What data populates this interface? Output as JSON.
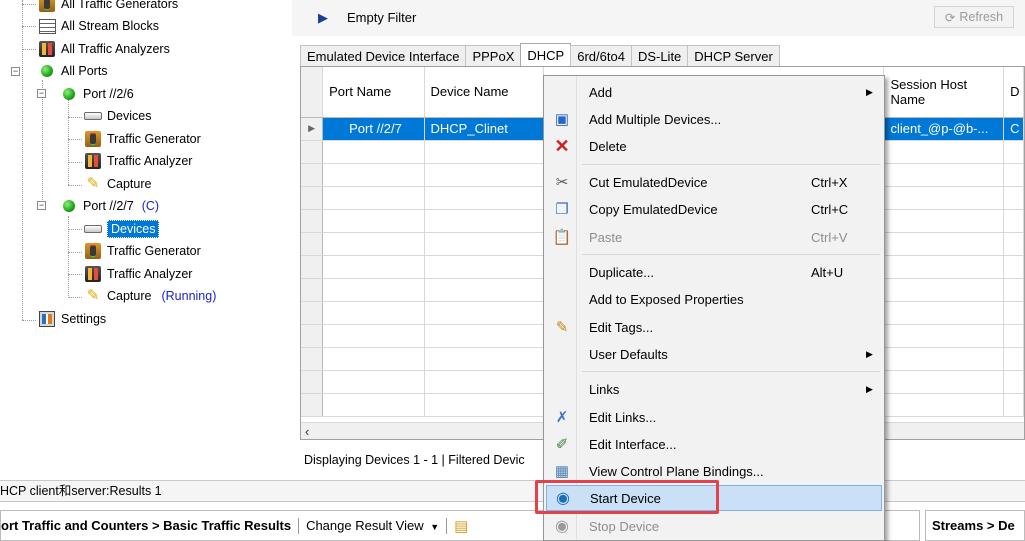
{
  "tree": {
    "items": [
      {
        "label": "All Traffic Generators",
        "icon": "traffic-generator-icon"
      },
      {
        "label": "All Stream Blocks",
        "icon": "stream-blocks-icon"
      },
      {
        "label": "All Traffic Analyzers",
        "icon": "traffic-analyzer-icon"
      },
      {
        "label": "All Ports",
        "icon": "port-status-icon"
      },
      {
        "label": "Port //2/6",
        "icon": "port-status-icon"
      },
      {
        "label": "Devices",
        "icon": "devices-icon"
      },
      {
        "label": "Traffic Generator",
        "icon": "traffic-generator-icon"
      },
      {
        "label": "Traffic Analyzer",
        "icon": "traffic-analyzer-icon"
      },
      {
        "label": "Capture",
        "icon": "capture-icon"
      },
      {
        "label": "Port //2/7",
        "suffix": "(C)",
        "icon": "port-status-icon"
      },
      {
        "label": "Devices",
        "icon": "devices-icon"
      },
      {
        "label": "Traffic Generator",
        "icon": "traffic-generator-icon"
      },
      {
        "label": "Traffic Analyzer",
        "icon": "traffic-analyzer-icon"
      },
      {
        "label": "Capture",
        "suffix": "(Running)",
        "icon": "capture-icon"
      },
      {
        "label": "Settings",
        "icon": "settings-icon"
      }
    ]
  },
  "toolbar": {
    "filter_label": "Empty Filter",
    "refresh_label": "Refresh"
  },
  "tabs": [
    {
      "label": "Emulated Device Interface"
    },
    {
      "label": "PPPoX"
    },
    {
      "label": "DHCP",
      "active": true
    },
    {
      "label": "6rd/6to4"
    },
    {
      "label": "DS-Lite"
    },
    {
      "label": "DHCP Server"
    }
  ],
  "grid": {
    "columns": [
      "Port Name",
      "Device Name",
      "Session Host Name",
      "D"
    ],
    "rows": [
      {
        "port_name": "Port //2/7",
        "device_name": "DHCP_Clinet",
        "session_host": "client_@p-@b-...",
        "d": "C"
      }
    ]
  },
  "status": {
    "text": "Displaying Devices 1 - 1  |  Filtered Devic"
  },
  "results": {
    "title": "HCP client和server:Results 1",
    "breadcrumb": "ort Traffic and Counters > Basic Traffic Results",
    "change_view": "Change Result View",
    "streams_label": "Streams > De"
  },
  "menu": {
    "items": [
      {
        "label": "Add",
        "submenu": true,
        "icon": ""
      },
      {
        "label": "Add Multiple Devices...",
        "icon": "add-multiple-devices-icon"
      },
      {
        "label": "Delete",
        "icon": "delete-icon"
      },
      {
        "label": "Cut EmulatedDevice",
        "shortcut": "Ctrl+X",
        "icon": "cut-icon"
      },
      {
        "label": "Copy EmulatedDevice",
        "shortcut": "Ctrl+C",
        "icon": "copy-icon"
      },
      {
        "label": "Paste",
        "shortcut": "Ctrl+V",
        "icon": "paste-icon",
        "disabled": true
      },
      {
        "label": "Duplicate...",
        "shortcut": "Alt+U",
        "icon": ""
      },
      {
        "label": "Add to Exposed Properties",
        "icon": ""
      },
      {
        "label": "Edit Tags...",
        "icon": "edit-tags-icon"
      },
      {
        "label": "User Defaults",
        "submenu": true,
        "icon": ""
      },
      {
        "label": "Links",
        "submenu": true,
        "icon": ""
      },
      {
        "label": "Edit Links...",
        "icon": "edit-links-icon"
      },
      {
        "label": "Edit Interface...",
        "icon": "edit-interface-icon"
      },
      {
        "label": "View Control Plane Bindings...",
        "icon": "bindings-icon"
      },
      {
        "label": "Start Device",
        "icon": "start-device-icon",
        "highlighted": true
      },
      {
        "label": "Stop Device",
        "icon": "stop-device-icon",
        "disabled": true
      }
    ]
  },
  "colors": {
    "selection": "#0078d7",
    "highlight_box": "#e3424b",
    "running_text": "#1c24c8"
  }
}
